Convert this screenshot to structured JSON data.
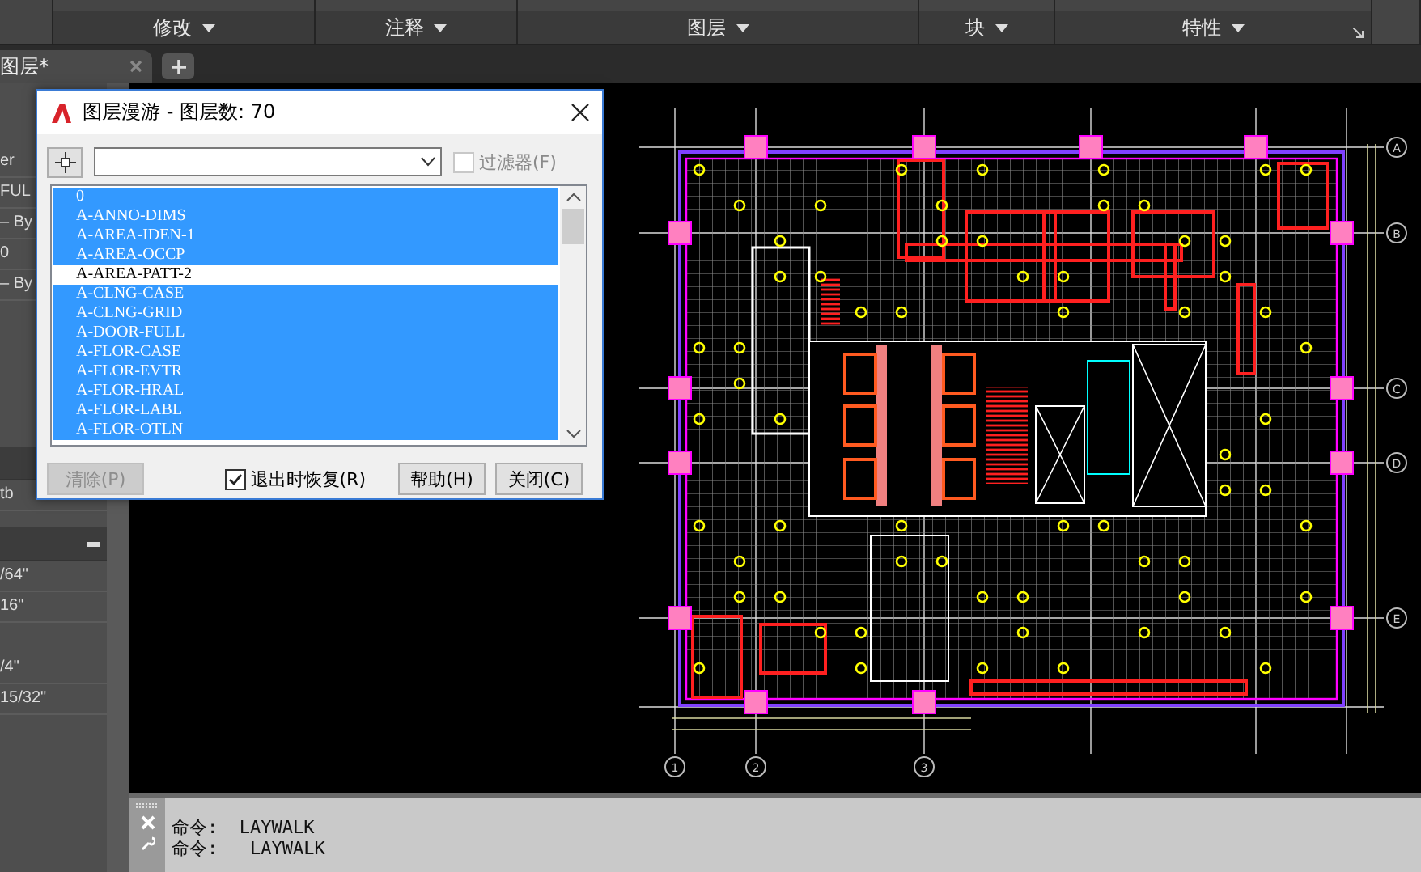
{
  "ribbon": {
    "panels": [
      {
        "label": "修改"
      },
      {
        "label": "注释"
      },
      {
        "label": "图层"
      },
      {
        "label": "块"
      },
      {
        "label": "特性",
        "launcher": true
      }
    ]
  },
  "doc_tabs": [
    {
      "label": "图层*",
      "selected": true
    }
  ],
  "property_panel": {
    "sections": [
      {
        "rows": [
          "er",
          "FUL",
          "– By",
          "0",
          "– By"
        ]
      },
      {
        "rows": [
          "tb"
        ]
      },
      {
        "rows": [
          "/64\"",
          "16\"",
          "/4\"",
          "15/32\""
        ]
      }
    ]
  },
  "dialog": {
    "title": "图层漫游 - 图层数: 70",
    "filter_checkbox": {
      "label": "过滤器(F)",
      "checked": false
    },
    "layers": [
      {
        "name": "0",
        "selected": true
      },
      {
        "name": "A-ANNO-DIMS",
        "selected": true
      },
      {
        "name": "A-AREA-IDEN-1",
        "selected": true
      },
      {
        "name": "A-AREA-OCCP",
        "selected": true
      },
      {
        "name": "A-AREA-PATT-2",
        "selected": false
      },
      {
        "name": "A-CLNG-CASE",
        "selected": true
      },
      {
        "name": "A-CLNG-GRID",
        "selected": true
      },
      {
        "name": "A-DOOR-FULL",
        "selected": true
      },
      {
        "name": "A-FLOR-CASE",
        "selected": true
      },
      {
        "name": "A-FLOR-EVTR",
        "selected": true
      },
      {
        "name": "A-FLOR-HRAL",
        "selected": true
      },
      {
        "name": "A-FLOR-LABL",
        "selected": true
      },
      {
        "name": "A-FLOR-OTLN",
        "selected": true
      }
    ],
    "purge_button": {
      "label": "清除(P)",
      "disabled": true
    },
    "restore_checkbox": {
      "label": "退出时恢复(R)",
      "checked": true
    },
    "buttons": [
      "帮助(H)",
      "关闭(C)"
    ]
  },
  "drawing": {
    "row_axes": [
      "A",
      "B",
      "C",
      "D",
      "E"
    ],
    "column_axes": [
      "1",
      "2",
      "3"
    ]
  },
  "command_line": {
    "history": [
      "命令:  LAYWALK",
      "命令:   LAYWALK"
    ]
  }
}
